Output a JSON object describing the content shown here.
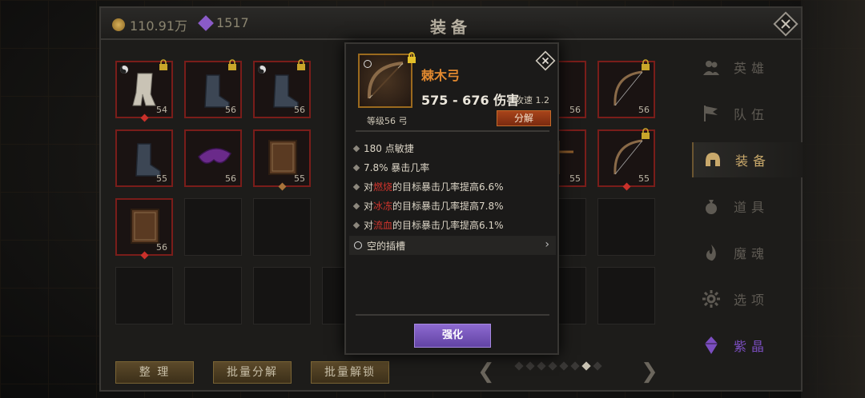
{
  "header": {
    "gold": "110.91万",
    "gems": "1517",
    "title": "装备"
  },
  "inventory": {
    "slots": [
      {
        "row": 0,
        "col": 0,
        "level": "54",
        "item": "leg-armor-icon",
        "locked": true,
        "tag": true,
        "dot": "red"
      },
      {
        "row": 0,
        "col": 1,
        "level": "56",
        "item": "boots-icon",
        "locked": true,
        "tag": false,
        "dot": "none"
      },
      {
        "row": 0,
        "col": 2,
        "level": "56",
        "item": "boots-icon",
        "locked": true,
        "tag": true,
        "dot": "none"
      },
      {
        "row": 0,
        "col": 7,
        "level": "56",
        "item": "bow-icon",
        "locked": true,
        "tag": false,
        "dot": "none"
      },
      {
        "row": 1,
        "col": 0,
        "level": "55",
        "item": "boots-icon",
        "locked": false,
        "tag": false,
        "dot": "none"
      },
      {
        "row": 1,
        "col": 1,
        "level": "56",
        "item": "mask-icon",
        "locked": false,
        "tag": false,
        "dot": "none"
      },
      {
        "row": 1,
        "col": 2,
        "level": "55",
        "item": "book-icon",
        "locked": false,
        "tag": false,
        "dot": "brown"
      },
      {
        "row": 1,
        "col": 6,
        "level": "55",
        "item": "crossbow-icon",
        "locked": false,
        "tag": false,
        "dot": "none"
      },
      {
        "row": 1,
        "col": 7,
        "level": "55",
        "item": "bow-icon",
        "locked": true,
        "tag": false,
        "dot": "red"
      },
      {
        "row": 2,
        "col": 0,
        "level": "56",
        "item": "book-icon",
        "locked": false,
        "tag": false,
        "dot": "red"
      }
    ],
    "partial_levels": {
      "r0c6": "56"
    }
  },
  "bottom": {
    "sort": "整 理",
    "batch_decompose": "批量分解",
    "batch_unlock": "批量解锁",
    "pages_total": 8,
    "page_active": 7
  },
  "menu": {
    "items": [
      {
        "label": "英雄",
        "icon": "heroes-icon",
        "active": false
      },
      {
        "label": "队伍",
        "icon": "flag-icon",
        "active": false
      },
      {
        "label": "装备",
        "icon": "helmet-icon",
        "active": true
      },
      {
        "label": "道具",
        "icon": "bag-icon",
        "active": false
      },
      {
        "label": "魔魂",
        "icon": "flame-icon",
        "active": false
      },
      {
        "label": "选项",
        "icon": "gear-icon",
        "active": false
      },
      {
        "label": "紫晶",
        "icon": "crystal-icon",
        "active": false,
        "purple": true
      }
    ]
  },
  "popup": {
    "name": "棘木弓",
    "damage": "575 - 676 伤害",
    "speed": "攻速 1.2",
    "level": "等级56 弓",
    "decompose": "分解",
    "stats": [
      {
        "pre": "180 点敏捷",
        "hl": "",
        "post": ""
      },
      {
        "pre": "7.8% 暴击几率",
        "hl": "",
        "post": ""
      },
      {
        "pre": "对",
        "hl": "燃烧",
        "post": "的目标暴击几率提高6.6%"
      },
      {
        "pre": "对",
        "hl": "冰冻",
        "post": "的目标暴击几率提高7.8%"
      },
      {
        "pre": "对",
        "hl": "流血",
        "post": "的目标暴击几率提高6.1%"
      }
    ],
    "socket": "空的插槽",
    "enhance": "强化"
  },
  "colors": {
    "item_name": "#e2892f",
    "highlight": "#d2342c",
    "enhance": "#7a56bf",
    "decompose": "#a8441a"
  }
}
